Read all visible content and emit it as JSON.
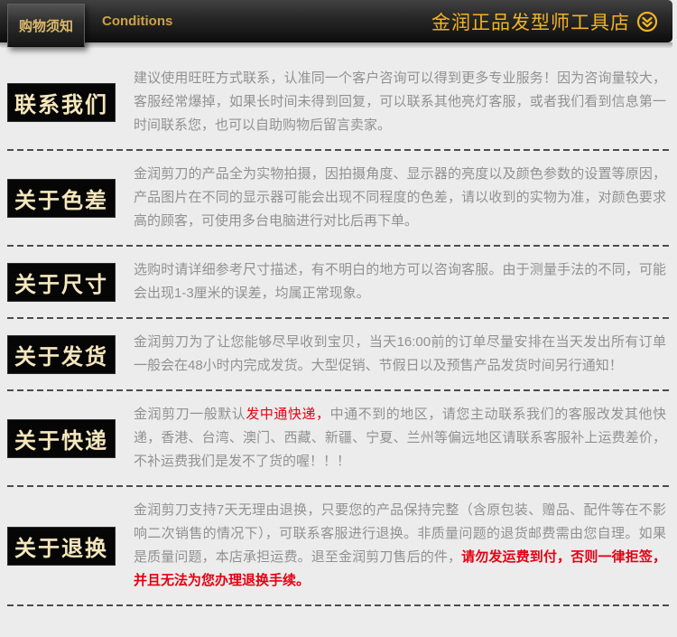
{
  "header": {
    "tab_label": "购物须知",
    "subtitle": "Conditions",
    "store_name": "金润正品发型师工具店",
    "icon": "chevron-down-circle-icon"
  },
  "colors": {
    "accent_gold": "#f2b322",
    "tab_gold": "#dcb96c",
    "highlight_red": "#e60012",
    "label_bg": "#060606",
    "label_text": "#f5e6bd",
    "body_text": "#919191"
  },
  "sections": [
    {
      "label": "联系我们",
      "segments": [
        {
          "style": "normal",
          "text": "建议使用旺旺方式联系，认准同一个客户咨询可以得到更多专业服务！因为咨询量较大，客服经常爆掉，如果长时间未得到回复，可以联系其他亮灯客服，或者我们看到信息第一时间联系您，也可以自助购物后留言卖家。"
        }
      ]
    },
    {
      "label": "关于色差",
      "segments": [
        {
          "style": "normal",
          "text": "金润剪刀的产品全为实物拍摄，因拍摄角度、显示器的亮度以及颜色参数的设置等原因，产品图片在不同的显示器可能会出现不同程度的色差，请以收到的实物为准，对颜色要求高的顾客，可使用多台电脑进行对比后再下单。"
        }
      ]
    },
    {
      "label": "关于尺寸",
      "segments": [
        {
          "style": "normal",
          "text": "选购时请详细参考尺寸描述，有不明白的地方可以咨询客服。由于测量手法的不同，可能会出现1-3厘米的误差，均属正常现象。"
        }
      ]
    },
    {
      "label": "关于发货",
      "segments": [
        {
          "style": "normal",
          "text": "金润剪刀为了让您能够尽早收到宝贝，当天16:00前的订单尽量安排在当天发出所有订单一般会在48小时内完成发货。大型促销、节假日以及预售产品发货时间另行通知！"
        }
      ]
    },
    {
      "label": "关于快递",
      "segments": [
        {
          "style": "normal",
          "text": "金润剪刀一般默认"
        },
        {
          "style": "red",
          "text": "发中通快递，"
        },
        {
          "style": "normal",
          "text": "中通不到的地区，请您主动联系我们的客服改发其他快递，香港、台湾、澳门、西藏、新疆、宁夏、兰州等偏远地区请联系客服补上运费差价，不补运费我们是发不了货的喔！！！"
        }
      ]
    },
    {
      "label": "关于退换",
      "segments": [
        {
          "style": "normal",
          "text": "金润剪刀支持7天无理由退换，只要您的产品保持完整（含原包装、赠品、配件等在不影响二次销售的情况下），可联系客服进行退换。非质量问题的退货邮费需由您自理。如果是质量问题，本店承担运费。退至金润剪刀售后的件，"
        },
        {
          "style": "red-bold",
          "text": "请勿发运费到付，否则一律拒签，并且无法为您办理退换手续。"
        }
      ]
    }
  ]
}
